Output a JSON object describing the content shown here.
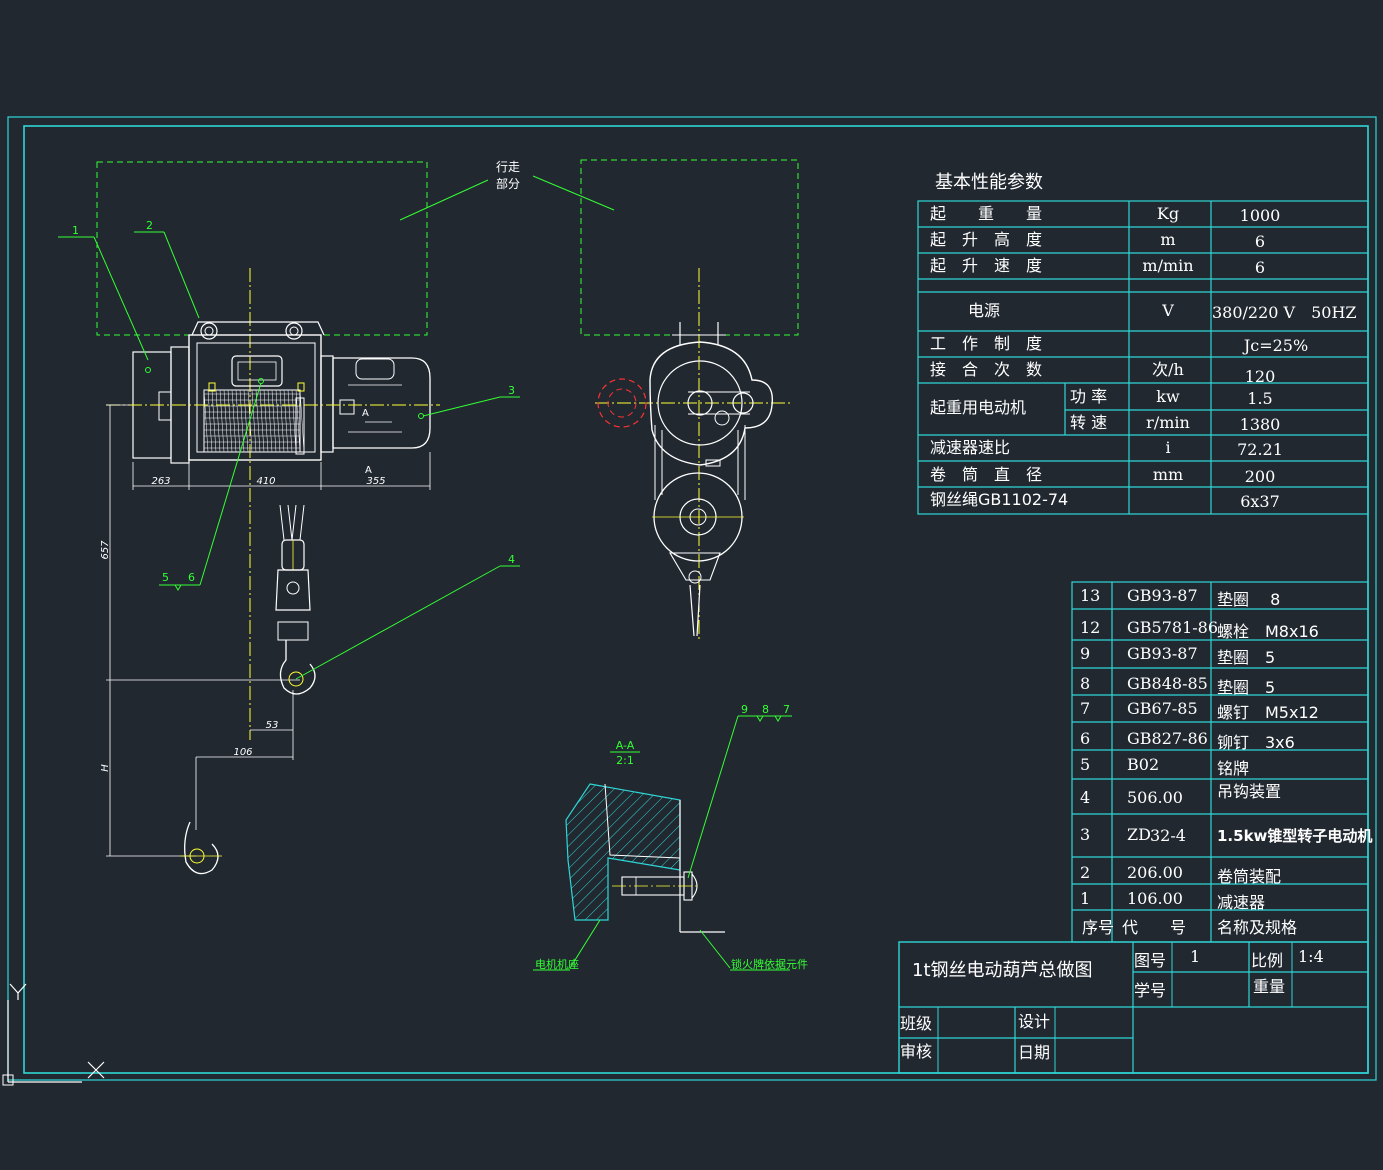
{
  "colors": {
    "background": "#212830",
    "frame": "#2fd6d6",
    "object": "#ffffff",
    "leader": "#33ff33",
    "center_line": "#ffff33",
    "hidden": "#ff3333"
  },
  "drawing": {
    "traveling_label_line1": "行走",
    "traveling_label_line2": "部分",
    "section_label": "A-A",
    "section_scale": "2:1",
    "section_mark": "A",
    "section_note_left": "电机机座",
    "section_note_right": "锁火牌依据元件",
    "balloons": [
      "1",
      "2",
      "3",
      "4",
      "5",
      "6",
      "9",
      "8",
      "7"
    ],
    "dimensions": {
      "d263": "263",
      "d410": "410",
      "d355": "355",
      "d657": "657",
      "d53": "53",
      "d106": "106",
      "dH": "H"
    }
  },
  "performance": {
    "title": "基本性能参数",
    "rows": [
      {
        "name": "起　　重　　量",
        "sub": "",
        "unit": "Kg",
        "value": "1000"
      },
      {
        "name": "起　升　高　度",
        "sub": "",
        "unit": "m",
        "value": "6"
      },
      {
        "name": "起　升　速　度",
        "sub": "",
        "unit": "m/min",
        "value": "6"
      },
      {
        "name": "电源",
        "sub": "",
        "unit": "V",
        "value": "380/220 V　50HZ"
      },
      {
        "name": "工　作　制　度",
        "sub": "",
        "unit": "",
        "value": "Jc=25%"
      },
      {
        "name": "接　合　次　数",
        "sub": "",
        "unit": "次/h",
        "value": "120"
      },
      {
        "name": "起重用电动机",
        "sub": "功 率",
        "unit": "kw",
        "value": "1.5"
      },
      {
        "name": "",
        "sub": "转 速",
        "unit": "r/min",
        "value": "1380"
      },
      {
        "name": "减速器速比",
        "sub": "",
        "unit": "i",
        "value": "72.21"
      },
      {
        "name": "卷　筒　直　径",
        "sub": "",
        "unit": "mm",
        "value": "200"
      },
      {
        "name": "钢丝绳GB1102-74",
        "sub": "",
        "unit": "",
        "value": "6x37"
      }
    ]
  },
  "parts": {
    "header": {
      "no": "序号",
      "code": "代　　号",
      "name": "名称及规格"
    },
    "rows": [
      {
        "no": "13",
        "code": "GB93-87",
        "name": "垫圈　 8"
      },
      {
        "no": "12",
        "code": "GB5781-86",
        "name": "螺栓　M8x16"
      },
      {
        "no": "9",
        "code": "GB93-87",
        "name": "垫圈　5"
      },
      {
        "no": "8",
        "code": "GB848-85",
        "name": "垫圈　5"
      },
      {
        "no": "7",
        "code": "GB67-85",
        "name": "螺钉　M5x12"
      },
      {
        "no": "6",
        "code": "GB827-86",
        "name": "铆钉　3x6"
      },
      {
        "no": "5",
        "code": "B02",
        "name": "铭牌"
      },
      {
        "no": "4",
        "code": "506.00",
        "name": "吊钩装置"
      },
      {
        "no": "3",
        "code": "ZD",
        "code_sub": "32-4",
        "name": "1.5kw锥型转子电动机"
      },
      {
        "no": "2",
        "code": "206.00",
        "name": "卷筒装配"
      },
      {
        "no": "1",
        "code": "106.00",
        "name": "减速器"
      }
    ]
  },
  "title_block": {
    "title": "1t钢丝电动葫芦总做图",
    "drawing_no_label": "图号",
    "drawing_no": "1",
    "scale_label": "比例",
    "scale": "1:4",
    "student_no_label": "学号",
    "weight_label": "重量",
    "class_label": "班级",
    "design_label": "设计",
    "review_label": "审核",
    "date_label": "日期"
  },
  "ucs": {
    "y": "Y",
    "x": "X"
  }
}
